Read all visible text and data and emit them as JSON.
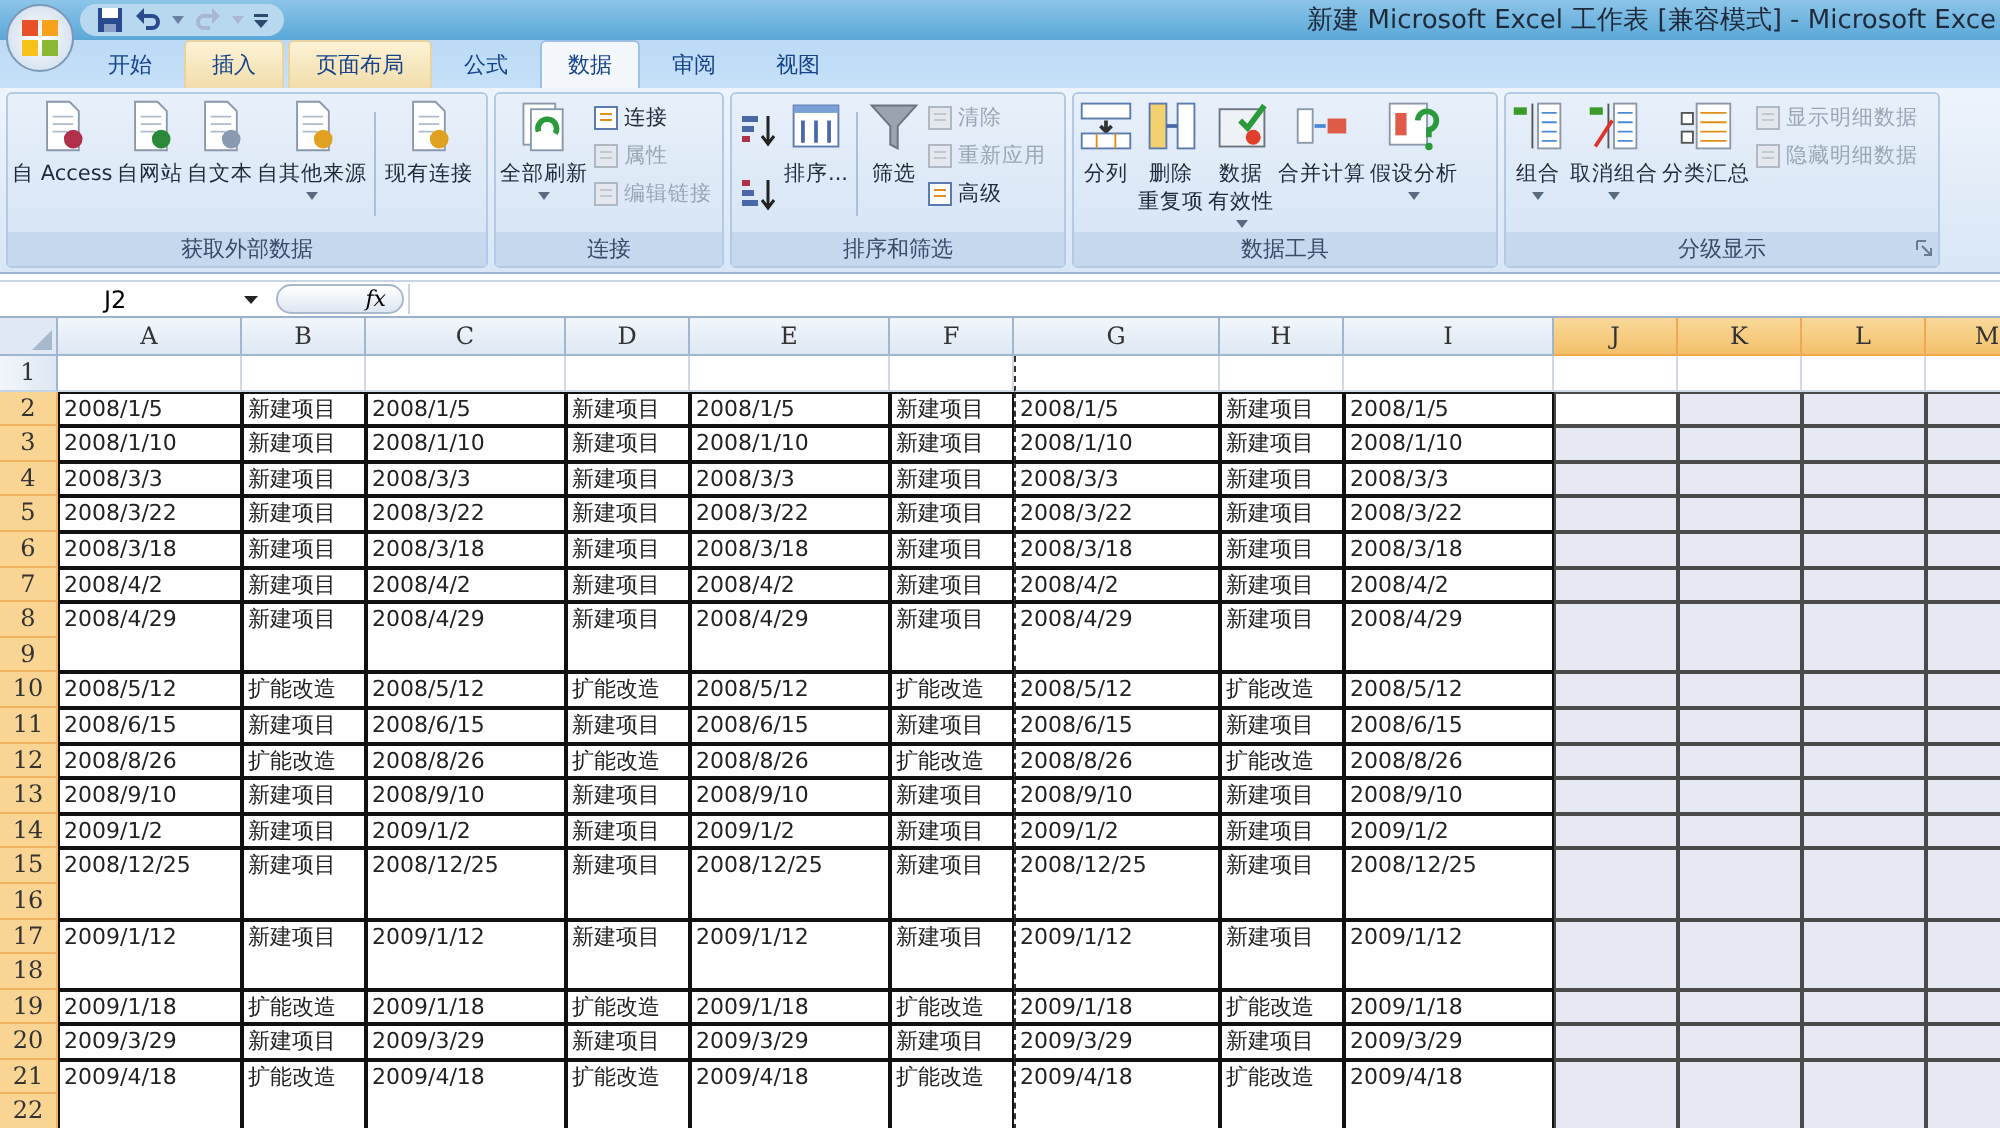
{
  "title_bar": {
    "title": "新建 Microsoft Excel 工作表  [兼容模式] - Microsoft Exce"
  },
  "tabs": [
    {
      "label": "开始",
      "selected": false,
      "highlighted": false
    },
    {
      "label": "插入",
      "selected": false,
      "highlighted": true
    },
    {
      "label": "页面布局",
      "selected": false,
      "highlighted": true
    },
    {
      "label": "公式",
      "selected": false,
      "highlighted": false
    },
    {
      "label": "数据",
      "selected": true,
      "highlighted": false
    },
    {
      "label": "审阅",
      "selected": false,
      "highlighted": false
    },
    {
      "label": "视图",
      "selected": false,
      "highlighted": false
    }
  ],
  "ribbon_groups": [
    {
      "title": "获取外部数据",
      "launcher": false,
      "items": [
        {
          "kind": "large",
          "lines": [
            "自 Access"
          ],
          "dropdown": false
        },
        {
          "kind": "large",
          "lines": [
            "自网站"
          ],
          "dropdown": false
        },
        {
          "kind": "large",
          "lines": [
            "自文本"
          ],
          "dropdown": false
        },
        {
          "kind": "large",
          "lines": [
            "自其他来源"
          ],
          "dropdown": true
        },
        {
          "kind": "separator"
        },
        {
          "kind": "large",
          "lines": [
            "现有连接"
          ],
          "dropdown": false
        }
      ]
    },
    {
      "title": "连接",
      "launcher": false,
      "items": [
        {
          "kind": "large",
          "lines": [
            "全部刷新"
          ],
          "dropdown": true
        },
        {
          "kind": "stack",
          "buttons": [
            {
              "label": "连接",
              "disabled": false
            },
            {
              "label": "属性",
              "disabled": true
            },
            {
              "label": "编辑链接",
              "disabled": true
            }
          ]
        }
      ]
    },
    {
      "title": "排序和筛选",
      "launcher": false,
      "items": [
        {
          "kind": "sort"
        },
        {
          "kind": "large",
          "lines": [
            "排序..."
          ],
          "dropdown": false
        },
        {
          "kind": "separator"
        },
        {
          "kind": "large",
          "lines": [
            "筛选"
          ],
          "dropdown": false
        },
        {
          "kind": "stack",
          "buttons": [
            {
              "label": "清除",
              "disabled": true
            },
            {
              "label": "重新应用",
              "disabled": true
            },
            {
              "label": "高级",
              "disabled": false
            }
          ]
        }
      ]
    },
    {
      "title": "数据工具",
      "launcher": false,
      "items": [
        {
          "kind": "large",
          "lines": [
            "分列"
          ],
          "dropdown": false
        },
        {
          "kind": "large",
          "lines": [
            "删除",
            "重复项"
          ],
          "dropdown": false
        },
        {
          "kind": "large",
          "lines": [
            "数据",
            "有效性"
          ],
          "dropdown": true
        },
        {
          "kind": "large",
          "lines": [
            "合并计算"
          ],
          "dropdown": false
        },
        {
          "kind": "large",
          "lines": [
            "假设分析"
          ],
          "dropdown": true
        }
      ]
    },
    {
      "title": "分级显示",
      "launcher": true,
      "items": [
        {
          "kind": "large",
          "lines": [
            "组合"
          ],
          "dropdown": true
        },
        {
          "kind": "large",
          "lines": [
            "取消组合"
          ],
          "dropdown": true
        },
        {
          "kind": "large",
          "lines": [
            "分类汇总"
          ],
          "dropdown": false
        },
        {
          "kind": "stack",
          "buttons": [
            {
              "label": "显示明细数据",
              "disabled": true
            },
            {
              "label": "隐藏明细数据",
              "disabled": true
            }
          ]
        }
      ]
    }
  ],
  "name_box": {
    "value": "J2"
  },
  "formula_bar": {
    "function_label": "fx"
  },
  "columns": [
    {
      "label": "A",
      "selected": false
    },
    {
      "label": "B",
      "selected": false
    },
    {
      "label": "C",
      "selected": false
    },
    {
      "label": "D",
      "selected": false
    },
    {
      "label": "E",
      "selected": false
    },
    {
      "label": "F",
      "selected": false
    },
    {
      "label": "G",
      "selected": false
    },
    {
      "label": "H",
      "selected": false
    },
    {
      "label": "I",
      "selected": false
    },
    {
      "label": "J",
      "selected": true
    },
    {
      "label": "K",
      "selected": true
    },
    {
      "label": "L",
      "selected": true
    },
    {
      "label": "M",
      "selected": true
    }
  ],
  "rows": [
    {
      "label": "1",
      "selected": false
    },
    {
      "label": "2",
      "selected": true
    },
    {
      "label": "3",
      "selected": true
    },
    {
      "label": "4",
      "selected": true
    },
    {
      "label": "5",
      "selected": true
    },
    {
      "label": "6",
      "selected": true
    },
    {
      "label": "7",
      "selected": true
    },
    {
      "label": "8",
      "selected": true
    },
    {
      "label": "9",
      "selected": true
    },
    {
      "label": "10",
      "selected": true
    },
    {
      "label": "11",
      "selected": true
    },
    {
      "label": "12",
      "selected": true
    },
    {
      "label": "13",
      "selected": true
    },
    {
      "label": "14",
      "selected": true
    },
    {
      "label": "15",
      "selected": true
    },
    {
      "label": "16",
      "selected": true
    },
    {
      "label": "17",
      "selected": true
    },
    {
      "label": "18",
      "selected": true
    },
    {
      "label": "19",
      "selected": true
    },
    {
      "label": "20",
      "selected": true
    },
    {
      "label": "21",
      "selected": true
    },
    {
      "label": "22",
      "selected": true
    }
  ],
  "records": [
    {
      "merged": false,
      "active": true,
      "cells": [
        "2008/1/5",
        "新建项目",
        "2008/1/5",
        "新建项目",
        "2008/1/5",
        "新建项目",
        "2008/1/5",
        "新建项目",
        "2008/1/5"
      ]
    },
    {
      "merged": false,
      "active": false,
      "cells": [
        "2008/1/10",
        "新建项目",
        "2008/1/10",
        "新建项目",
        "2008/1/10",
        "新建项目",
        "2008/1/10",
        "新建项目",
        "2008/1/10"
      ]
    },
    {
      "merged": false,
      "active": false,
      "cells": [
        "2008/3/3",
        "新建项目",
        "2008/3/3",
        "新建项目",
        "2008/3/3",
        "新建项目",
        "2008/3/3",
        "新建项目",
        "2008/3/3"
      ]
    },
    {
      "merged": false,
      "active": false,
      "cells": [
        "2008/3/22",
        "新建项目",
        "2008/3/22",
        "新建项目",
        "2008/3/22",
        "新建项目",
        "2008/3/22",
        "新建项目",
        "2008/3/22"
      ]
    },
    {
      "merged": false,
      "active": false,
      "cells": [
        "2008/3/18",
        "新建项目",
        "2008/3/18",
        "新建项目",
        "2008/3/18",
        "新建项目",
        "2008/3/18",
        "新建项目",
        "2008/3/18"
      ]
    },
    {
      "merged": false,
      "active": false,
      "cells": [
        "2008/4/2",
        "新建项目",
        "2008/4/2",
        "新建项目",
        "2008/4/2",
        "新建项目",
        "2008/4/2",
        "新建项目",
        "2008/4/2"
      ]
    },
    {
      "merged": true,
      "active": false,
      "cells": [
        "2008/4/29",
        "新建项目",
        "2008/4/29",
        "新建项目",
        "2008/4/29",
        "新建项目",
        "2008/4/29",
        "新建项目",
        "2008/4/29"
      ]
    },
    {
      "merged": false,
      "active": false,
      "cells": [
        "2008/5/12",
        "扩能改造",
        "2008/5/12",
        "扩能改造",
        "2008/5/12",
        "扩能改造",
        "2008/5/12",
        "扩能改造",
        "2008/5/12"
      ]
    },
    {
      "merged": false,
      "active": false,
      "cells": [
        "2008/6/15",
        "新建项目",
        "2008/6/15",
        "新建项目",
        "2008/6/15",
        "新建项目",
        "2008/6/15",
        "新建项目",
        "2008/6/15"
      ]
    },
    {
      "merged": false,
      "active": false,
      "cells": [
        "2008/8/26",
        "扩能改造",
        "2008/8/26",
        "扩能改造",
        "2008/8/26",
        "扩能改造",
        "2008/8/26",
        "扩能改造",
        "2008/8/26"
      ]
    },
    {
      "merged": false,
      "active": false,
      "cells": [
        "2008/9/10",
        "新建项目",
        "2008/9/10",
        "新建项目",
        "2008/9/10",
        "新建项目",
        "2008/9/10",
        "新建项目",
        "2008/9/10"
      ]
    },
    {
      "merged": false,
      "active": false,
      "cells": [
        "2009/1/2",
        "新建项目",
        "2009/1/2",
        "新建项目",
        "2009/1/2",
        "新建项目",
        "2009/1/2",
        "新建项目",
        "2009/1/2"
      ]
    },
    {
      "merged": true,
      "active": false,
      "cells": [
        "2008/12/25",
        "新建项目",
        "2008/12/25",
        "新建项目",
        "2008/12/25",
        "新建项目",
        "2008/12/25",
        "新建项目",
        "2008/12/25"
      ]
    },
    {
      "merged": true,
      "active": false,
      "cells": [
        "2009/1/12",
        "新建项目",
        "2009/1/12",
        "新建项目",
        "2009/1/12",
        "新建项目",
        "2009/1/12",
        "新建项目",
        "2009/1/12"
      ]
    },
    {
      "merged": false,
      "active": false,
      "cells": [
        "2009/1/18",
        "扩能改造",
        "2009/1/18",
        "扩能改造",
        "2009/1/18",
        "扩能改造",
        "2009/1/18",
        "扩能改造",
        "2009/1/18"
      ]
    },
    {
      "merged": false,
      "active": false,
      "cells": [
        "2009/3/29",
        "新建项目",
        "2009/3/29",
        "新建项目",
        "2009/3/29",
        "新建项目",
        "2009/3/29",
        "新建项目",
        "2009/3/29"
      ]
    },
    {
      "merged": true,
      "active": false,
      "cells": [
        "2009/4/18",
        "扩能改造",
        "2009/4/18",
        "扩能改造",
        "2009/4/18",
        "扩能改造",
        "2009/4/18",
        "扩能改造",
        "2009/4/18"
      ]
    }
  ]
}
